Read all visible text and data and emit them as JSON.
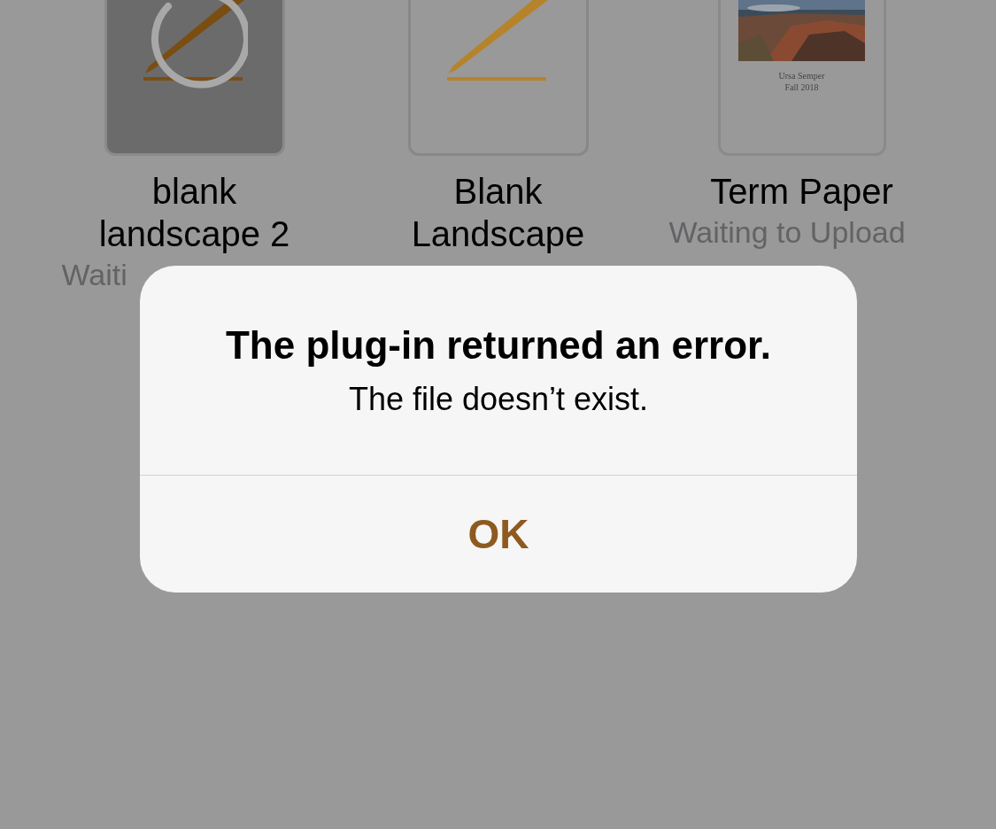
{
  "documents": [
    {
      "name": "blank landscape 2",
      "status": "Waiti",
      "kind": "blank",
      "busy": true
    },
    {
      "name": "Blank Landscape",
      "kind": "blank",
      "busy": false
    },
    {
      "name": "Term Paper",
      "status": "Waiting to Upload",
      "kind": "paper",
      "busy": false,
      "page_lines": [
        "Ursa Semper",
        "Fall 2018"
      ]
    }
  ],
  "alert": {
    "title": "The plug-in returned an error.",
    "message": "The file doesn’t exist.",
    "buttons": [
      "OK"
    ]
  }
}
